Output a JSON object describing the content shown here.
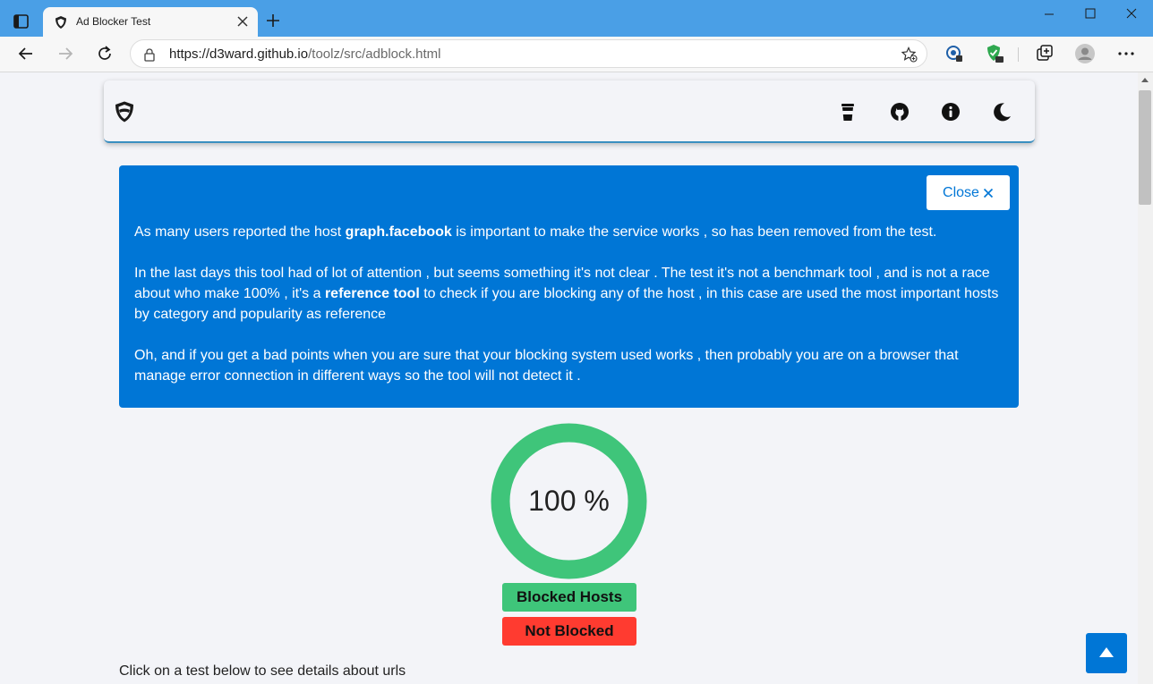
{
  "browser": {
    "tab_title": "Ad Blocker Test",
    "url_host": "https://d3ward.github.io",
    "url_path": "/toolz/src/adblock.html"
  },
  "alert": {
    "close_label": "Close",
    "p1_before": "As many users reported the host ",
    "p1_bold": "graph.facebook",
    "p1_after": " is important to make the service works , so has been removed from the test.",
    "p2_before": "In the last days this tool had of lot of attention , but seems something it's not clear . The test it's not a benchmark tool , and is not a race about who make 100% , it's a ",
    "p2_bold": "reference tool",
    "p2_after": " to check if you are blocking any of the host , in this case are used the most important hosts by category and popularity as reference",
    "p3": "Oh, and if you get a bad points when you are sure that your blocking system used works , then probably you are on a browser that manage error connection in different ways so the tool will not detect it ."
  },
  "score": {
    "percent_label": "100 %",
    "value": 100
  },
  "legend": {
    "blocked_label": "Blocked Hosts",
    "not_blocked_label": "Not Blocked"
  },
  "hint": "Click on a test below to see details about urls",
  "colors": {
    "titlebar": "#4a9fe6",
    "accent": "#0076d6",
    "blocked": "#3fc57a",
    "not_blocked": "#ff3b30",
    "page_bg": "#f3f4f8"
  },
  "icons": {
    "navbar": [
      "shield-logo-icon",
      "coffee-cup-icon",
      "github-icon",
      "info-icon",
      "moon-icon"
    ],
    "browser": [
      "tab-actions-icon",
      "back-arrow-icon",
      "forward-arrow-icon",
      "refresh-icon",
      "lock-icon",
      "favorites-star-icon",
      "extension-icon",
      "shield-extension-icon",
      "collections-icon",
      "profile-avatar-icon",
      "more-options-icon"
    ]
  }
}
